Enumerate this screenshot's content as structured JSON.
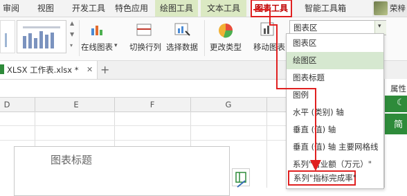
{
  "tabs": {
    "review": "审阅",
    "view": "视图",
    "devtools": "开发工具",
    "features": "特色应用",
    "drawing_tools": "绘图工具",
    "text_tools": "文本工具",
    "chart_tools": "图表工具",
    "smart_toolbox": "智能工具箱",
    "user_name": "荣梓"
  },
  "ribbon": {
    "online_chart": "在线图表",
    "switch_rowcol": "切换行列",
    "select_data": "选择数据",
    "change_type": "更改类型",
    "move_chart": "移动图表"
  },
  "element_select": {
    "value": "图表区"
  },
  "dropdown": {
    "items": [
      "图表区",
      "绘图区",
      "图表标题",
      "图例",
      "水平 (类别) 轴",
      "垂直 (值) 轴",
      "垂直 (值) 轴 主要网格线",
      "系列\"营业额（万元）\"",
      "系列\"指标完成率\""
    ]
  },
  "doc_tab": {
    "filename": "XLSX 工作表.xlsx *",
    "new_tab": "+"
  },
  "sheet": {
    "columns": [
      "D",
      "E",
      "F",
      "G"
    ]
  },
  "chart": {
    "title": "图表标题"
  },
  "right_pane": {
    "attr_label": "属性",
    "simple_label": "简"
  },
  "colors": {
    "highlight_red": "#e02020",
    "green_accent": "#2e8b3a",
    "selected_item_bg": "#d6e8d0"
  }
}
